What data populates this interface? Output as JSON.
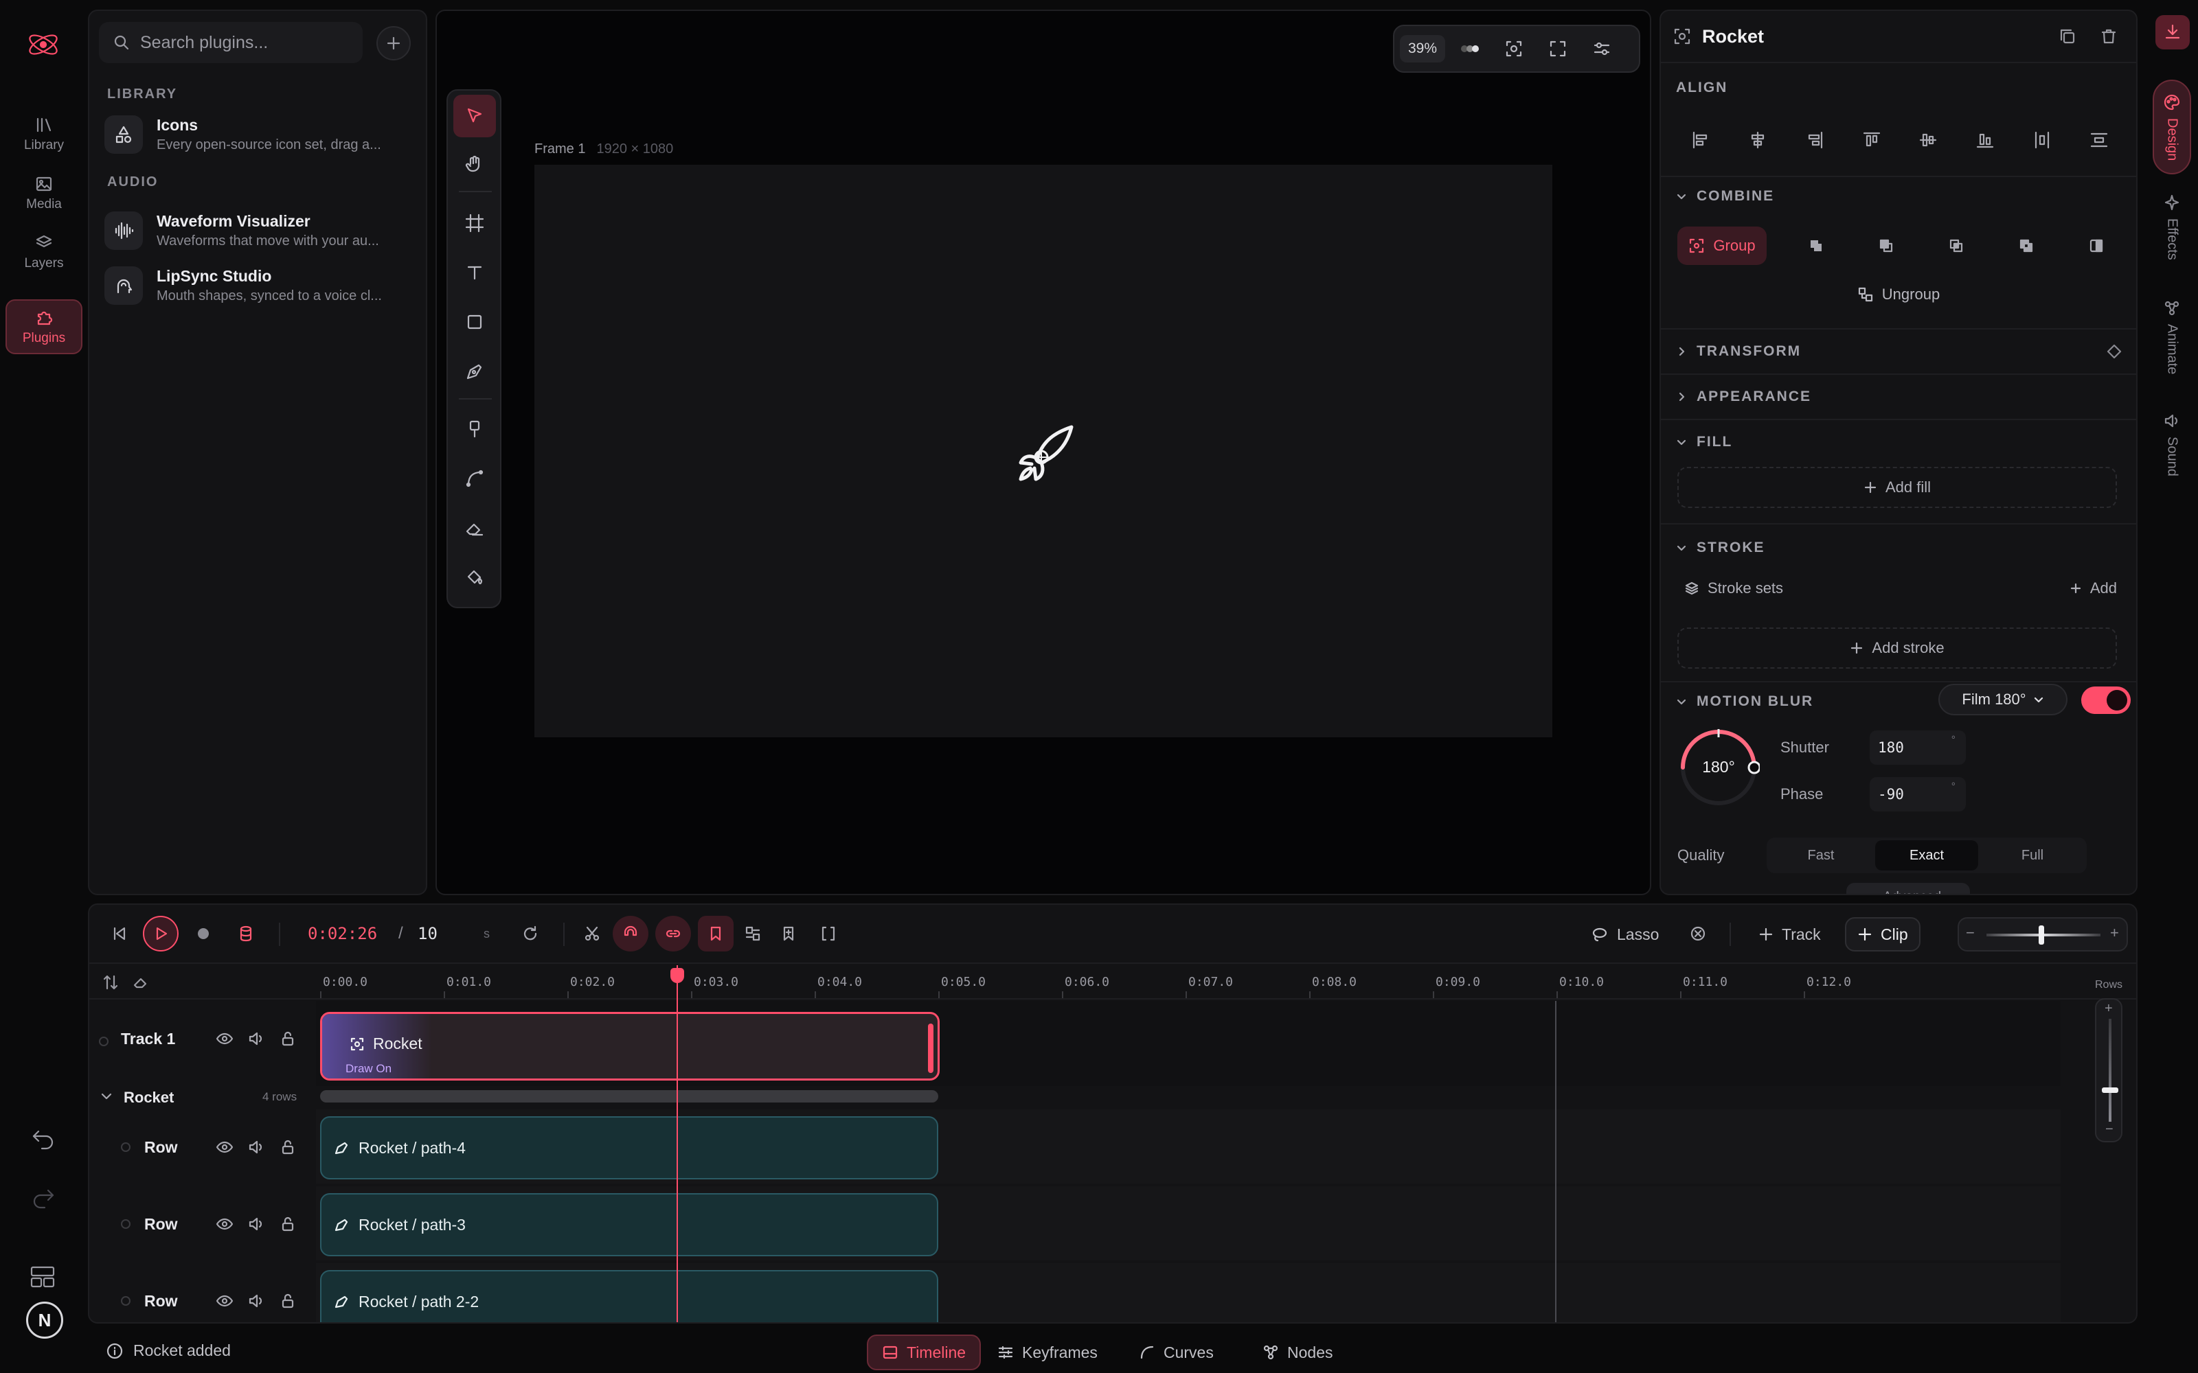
{
  "rail": {
    "items": [
      {
        "label": "Library",
        "icon": "library-icon"
      },
      {
        "label": "Media",
        "icon": "image-icon"
      },
      {
        "label": "Layers",
        "icon": "layers-icon"
      },
      {
        "label": "Plugins",
        "icon": "plugin-icon",
        "active": true
      }
    ],
    "avatar": "N"
  },
  "plugins": {
    "search_placeholder": "Search plugins...",
    "sections": [
      {
        "label": "LIBRARY",
        "items": [
          {
            "name": "Icons",
            "desc": "Every open-source icon set, drag a..."
          }
        ]
      },
      {
        "label": "AUDIO",
        "items": [
          {
            "name": "Waveform Visualizer",
            "desc": "Waveforms that move with your au..."
          },
          {
            "name": "LipSync Studio",
            "desc": "Mouth shapes, synced to a voice cl..."
          }
        ]
      }
    ]
  },
  "canvas": {
    "zoom": "39%",
    "frame_name": "Frame 1",
    "frame_size": "1920 × 1080"
  },
  "inspector": {
    "title": "Rocket",
    "align_label": "ALIGN",
    "combine_label": "COMBINE",
    "group_label": "Group",
    "ungroup_label": "Ungroup",
    "transform_label": "TRANSFORM",
    "appearance_label": "APPEARANCE",
    "fill_label": "FILL",
    "add_fill": "Add fill",
    "stroke_label": "STROKE",
    "stroke_sets": "Stroke sets",
    "add": "Add",
    "add_stroke": "Add stroke",
    "motion_blur_label": "MOTION BLUR",
    "film_mode": "Film 180°",
    "motion_blur_enabled": true,
    "dial_value": "180°",
    "shutter_label": "Shutter",
    "shutter_value": "180",
    "phase_label": "Phase",
    "phase_value": "-90",
    "unit": "°",
    "quality_label": "Quality",
    "quality_options": [
      "Fast",
      "Exact",
      "Full"
    ],
    "quality_selected": "Exact",
    "advanced": "Advanced"
  },
  "right_tabs": [
    "Design",
    "Effects",
    "Animate",
    "Sound"
  ],
  "timeline": {
    "timecode": "0:02:26",
    "slash": "/",
    "duration": "10",
    "duration_unit": "s",
    "lasso": "Lasso",
    "track_btn": "Track",
    "clip_btn": "Clip",
    "ruler": [
      "0:00.0",
      "0:01.0",
      "0:02.0",
      "0:03.0",
      "0:04.0",
      "0:05.0",
      "0:06.0",
      "0:07.0",
      "0:08.0",
      "0:09.0",
      "0:10.0",
      "0:11.0",
      "0:12.0"
    ],
    "rows_label": "Rows",
    "tracks": [
      {
        "name": "Track 1"
      },
      {
        "name": "Rocket",
        "meta": "4 rows"
      },
      {
        "name": "Row"
      },
      {
        "name": "Row"
      },
      {
        "name": "Row"
      }
    ],
    "main_clip": {
      "title": "Rocket",
      "sub": "Draw On"
    },
    "sub_clips": [
      "Rocket / path-4",
      "Rocket / path-3",
      "Rocket / path 2-2"
    ]
  },
  "status": {
    "message": "Rocket added"
  },
  "bottom_tabs": [
    {
      "label": "Timeline",
      "active": true
    },
    {
      "label": "Keyframes"
    },
    {
      "label": "Curves"
    },
    {
      "label": "Nodes"
    }
  ],
  "colors": {
    "accent": "#ff4d6a",
    "subclip": "#173034",
    "background": "#0a0a0b"
  }
}
